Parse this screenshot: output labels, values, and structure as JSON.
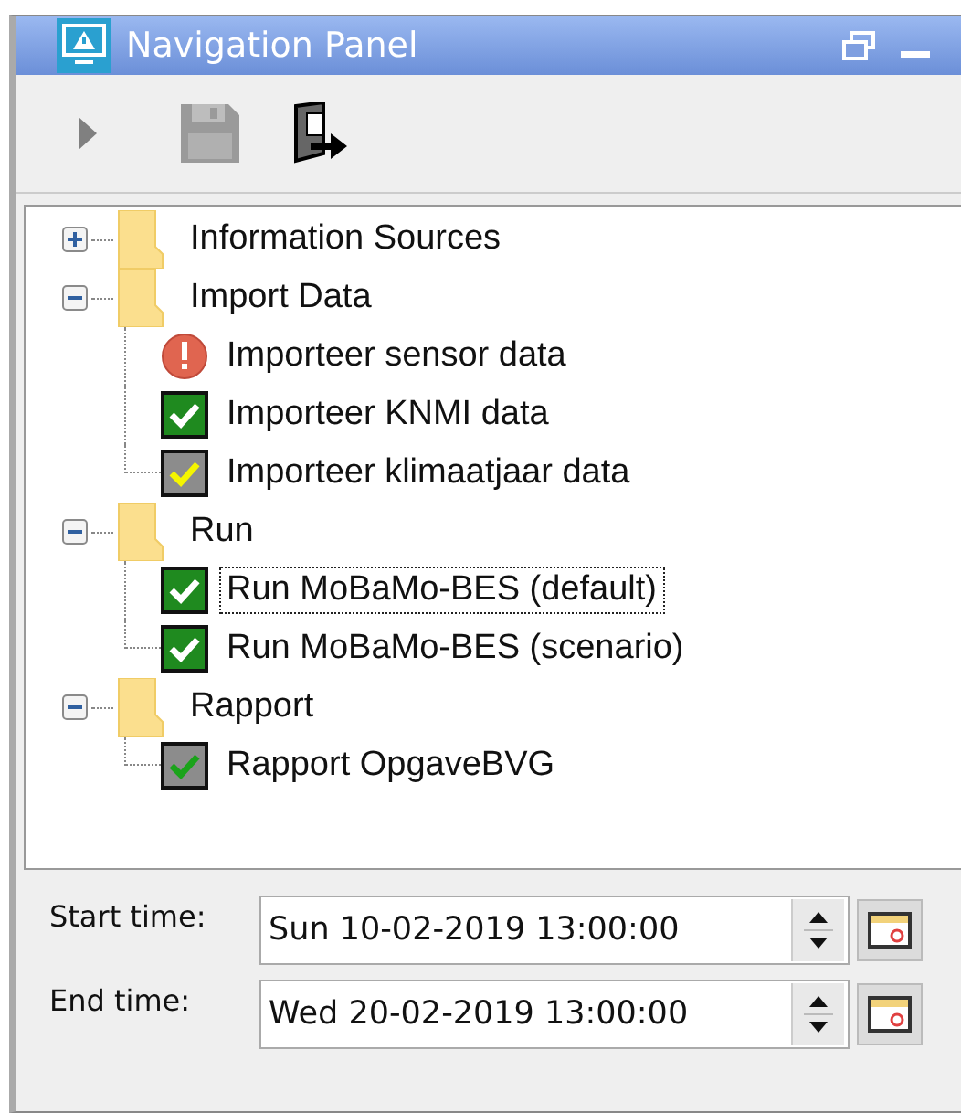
{
  "window": {
    "title": "Navigation Panel"
  },
  "tree": [
    {
      "label": "Information Sources",
      "expanded": false,
      "selected": false
    },
    {
      "label": "Import Data",
      "expanded": true,
      "selected": false,
      "children": [
        {
          "label": "Importeer sensor data",
          "kind": "error",
          "selected": false
        },
        {
          "label": "Importeer KNMI data",
          "kind": "done",
          "selected": false
        },
        {
          "label": "Importeer klimaatjaar data",
          "kind": "partial",
          "selected": false
        }
      ]
    },
    {
      "label": "Run",
      "expanded": true,
      "selected": false,
      "children": [
        {
          "label": "Run MoBaMo-BES (default)",
          "kind": "done",
          "selected": true
        },
        {
          "label": "Run MoBaMo-BES (scenario)",
          "kind": "done",
          "selected": false
        }
      ]
    },
    {
      "label": "Rapport",
      "expanded": true,
      "selected": false,
      "children": [
        {
          "label": "Rapport OpgaveBVG",
          "kind": "checked-grey",
          "selected": false
        }
      ]
    }
  ],
  "times": [
    {
      "label": "Start time:",
      "value": "Sun 10-02-2019 13:00:00"
    },
    {
      "label": "End time:",
      "value": "Wed 20-02-2019 13:00:00"
    }
  ]
}
